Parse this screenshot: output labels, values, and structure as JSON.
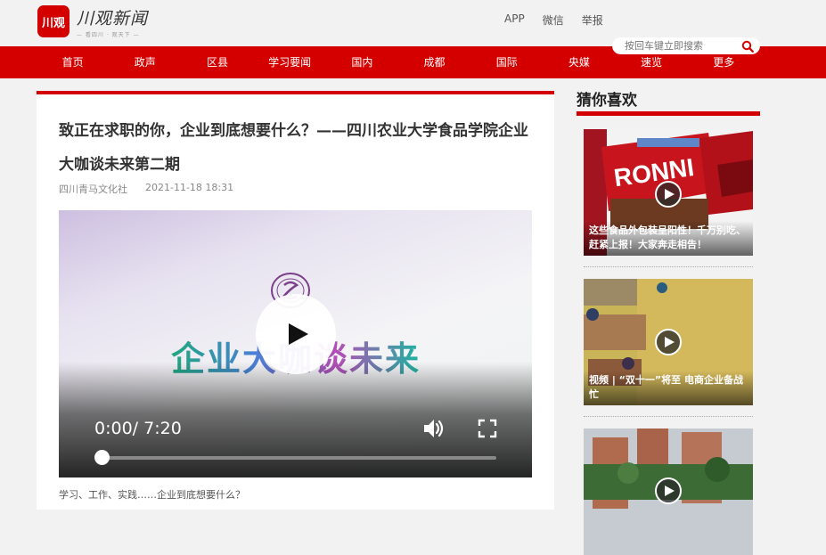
{
  "header": {
    "logo_mark": "川观",
    "logo_name": "川观新闻",
    "logo_slogan": "— 看四川 · 观天下 —",
    "links": [
      {
        "label": "APP"
      },
      {
        "label": "微信"
      },
      {
        "label": "举报"
      }
    ],
    "search_placeholder": "按回车键立即搜索"
  },
  "nav": {
    "items": [
      {
        "label": "首页"
      },
      {
        "label": "政声"
      },
      {
        "label": "区县"
      },
      {
        "label": "学习要闻"
      },
      {
        "label": "国内"
      },
      {
        "label": "成都"
      },
      {
        "label": "国际"
      },
      {
        "label": "央媒"
      },
      {
        "label": "速览"
      },
      {
        "label": "更多"
      }
    ]
  },
  "article": {
    "title": "致正在求职的你，企业到底想要什么？——四川农业大学食品学院企业大咖谈未来第二期",
    "source": "四川青马文化社",
    "datetime": "2021-11-18 18:31",
    "video": {
      "banner_text": "企业大咖谈未来",
      "current_time": "0:00",
      "duration": "7:20",
      "progress": 0
    },
    "intro": "学习、工作、实践……企业到底想要什么？"
  },
  "sidebar": {
    "title": "猜你喜欢",
    "items": [
      {
        "caption": "这些食品外包装呈阳性！千万别吃、赶紧上报！大家奔走相告！",
        "image_text": "RONNI"
      },
      {
        "caption": "视频 | “双十一”将至 电商企业备战忙",
        "image_text": ""
      },
      {
        "caption": "",
        "image_text": ""
      }
    ]
  },
  "colors": {
    "brand_red": "#d40000",
    "page_bg": "#f2f2f2"
  }
}
